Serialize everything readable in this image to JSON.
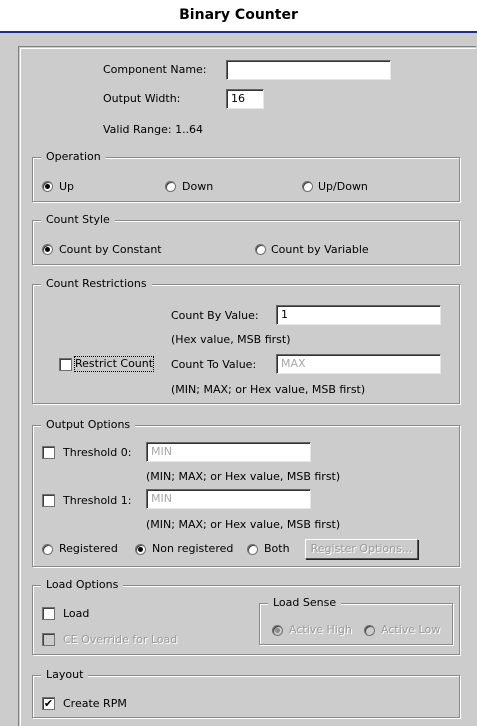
{
  "header": {
    "title": "Binary Counter"
  },
  "component": {
    "name_label": "Component Name:",
    "name_value": "",
    "width_label": "Output Width:",
    "width_value": "16",
    "valid_range": "Valid Range: 1..64"
  },
  "operation": {
    "legend": "Operation",
    "options": [
      "Up",
      "Down",
      "Up/Down"
    ],
    "selected": "Up"
  },
  "count_style": {
    "legend": "Count Style",
    "options": [
      "Count by Constant",
      "Count by Variable"
    ],
    "selected": "Count by Constant"
  },
  "count_restrictions": {
    "legend": "Count Restrictions",
    "by_label": "Count By Value:",
    "by_value": "1",
    "by_hint": "(Hex value, MSB first)",
    "restrict_label": "Restrict Count",
    "restrict_checked": false,
    "to_label": "Count To Value:",
    "to_value": "MAX",
    "to_hint": "(MIN; MAX; or Hex value, MSB first)"
  },
  "output_options": {
    "legend": "Output Options",
    "threshold0_label": "Threshold 0:",
    "threshold0_value": "MIN",
    "threshold0_hint": "(MIN; MAX; or Hex value, MSB first)",
    "threshold1_label": "Threshold 1:",
    "threshold1_value": "MIN",
    "threshold1_hint": "(MIN; MAX; or Hex value, MSB first)",
    "modes": [
      "Registered",
      "Non registered",
      "Both"
    ],
    "selected": "Non registered",
    "register_button": "Register Options..."
  },
  "load_options": {
    "legend": "Load Options",
    "load_label": "Load",
    "ce_label": "CE Override for Load",
    "sense_legend": "Load Sense",
    "sense_options": [
      "Active High",
      "Active Low"
    ],
    "sense_selected": "Active High"
  },
  "layout": {
    "legend": "Layout",
    "rpm_label": "Create RPM",
    "rpm_checked": true,
    "check_glyph": "✔"
  }
}
